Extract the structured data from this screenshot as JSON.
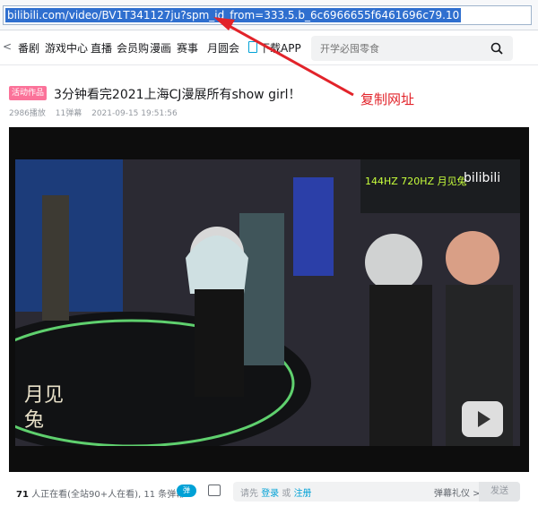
{
  "browser": {
    "url": "bilibili.com/video/BV1T341127ju?spm_id_from=333.5.b_6c6966655f6461696c79.10"
  },
  "nav": {
    "items": [
      "番剧",
      "游戏中心",
      "直播",
      "会员购",
      "漫画",
      "赛事",
      "月圆会"
    ],
    "download_label": "下载APP",
    "search_placeholder": "开学必囤零食"
  },
  "video": {
    "badge": "活动作品",
    "title": "3分钟看完2021上海CJ漫展所有show girl！",
    "views": "2986播放",
    "danmaku_count": "11弹幕",
    "date": "2021-09-15 19:51:56",
    "watermark": "月见兔"
  },
  "bottom_bar": {
    "viewer_count": "71",
    "viewer_text": "人正在看(全站90+人在看), 11 条弹幕",
    "toggle_label": "弹",
    "prompt_prefix": "请先",
    "login_label": "登录",
    "or_label": "或",
    "register_label": "注册",
    "etiquette_label": "弹幕礼仪 >",
    "send_label": "发送"
  },
  "annotation": {
    "text": "复制网址",
    "color": "#e2232a"
  }
}
